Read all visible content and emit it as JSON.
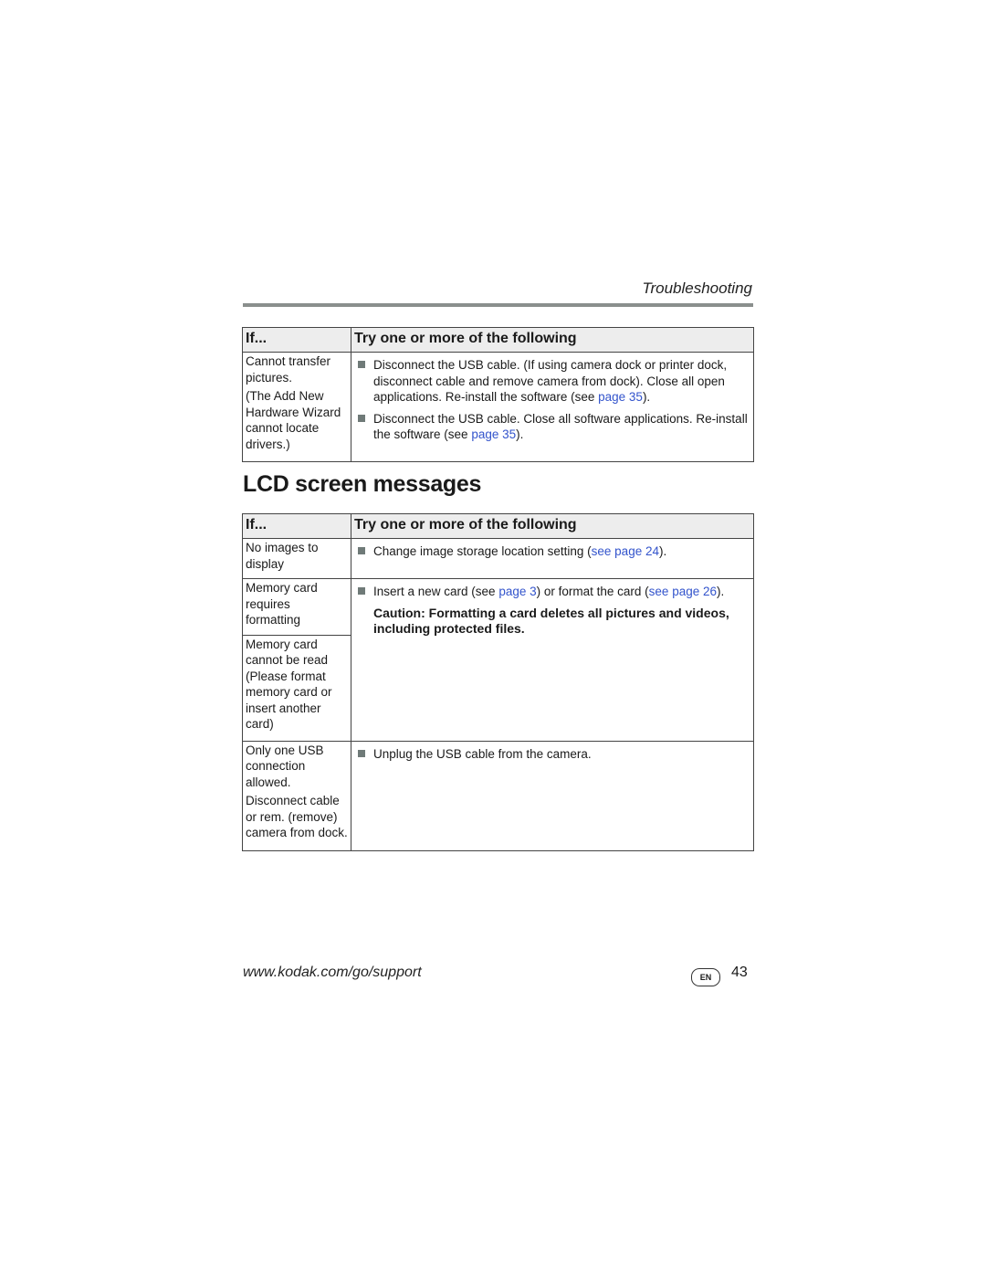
{
  "header": {
    "section": "Troubleshooting"
  },
  "table1": {
    "columns": [
      "If...",
      "Try one or more of the following"
    ],
    "rows": [
      {
        "if": [
          "Cannot transfer pictures.",
          "(The Add New Hardware Wizard cannot locate drivers.)"
        ],
        "solutions": [
          {
            "pre": "Disconnect the USB cable. (If using camera dock or printer dock, disconnect cable and remove camera from dock). Close all open applications. Re-install the software (see ",
            "link": "page 35",
            "post": ")."
          },
          {
            "pre": "Disconnect the USB cable. Close all software applications. Re-install the software (see ",
            "link": "page 35",
            "post": ")."
          }
        ]
      }
    ]
  },
  "heading": "LCD screen messages",
  "table2": {
    "columns": [
      "If...",
      "Try one or more of the following"
    ],
    "rows": [
      {
        "if": [
          "No images to display"
        ],
        "solutions": [
          {
            "pre": "Change image storage location setting (",
            "link": "see page 24",
            "post": ")."
          }
        ]
      },
      {
        "if": [
          "Memory card requires formatting"
        ],
        "if2": [
          "Memory card cannot be read (Please format memory card or insert another card)"
        ],
        "solutions": [
          {
            "pre": "Insert a new card (see ",
            "link": "page 3",
            "mid": ") or format the card (",
            "link2": "see page 26",
            "post": ")."
          }
        ],
        "caution": "Caution: Formatting a card deletes all pictures and videos, including protected files."
      },
      {
        "if": [
          "Only one USB connection allowed.",
          "Disconnect cable or rem. (remove) camera from dock."
        ],
        "solutions": [
          {
            "pre": "Unplug the USB cable from the camera."
          }
        ]
      }
    ]
  },
  "footer": {
    "url": "www.kodak.com/go/support",
    "lang_badge": "EN",
    "page_number": "43"
  },
  "colors": {
    "link": "#3354cc",
    "bullet": "#6f7a78",
    "header_bg": "#ededed",
    "rule": "#8a8f8d"
  }
}
